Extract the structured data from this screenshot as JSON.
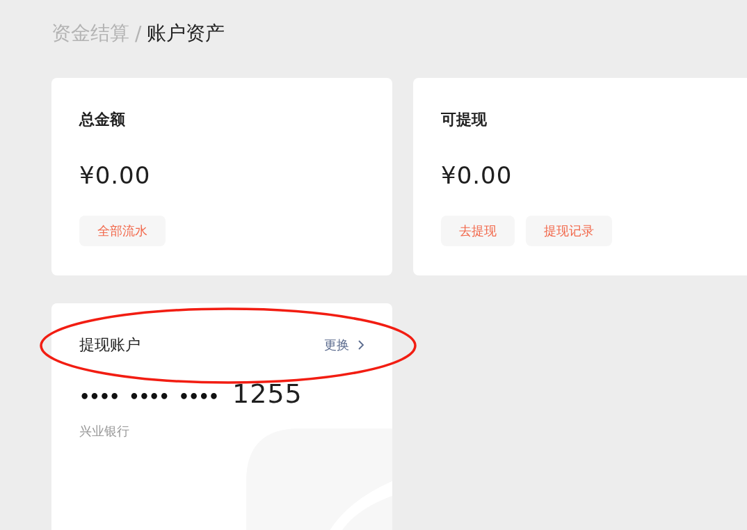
{
  "breadcrumb": {
    "parent": "资金结算",
    "separator": "/",
    "current": "账户资产"
  },
  "balance_cards": [
    {
      "title": "总金额",
      "amount": "¥0.00",
      "buttons": [
        "全部流水"
      ]
    },
    {
      "title": "可提现",
      "amount": "¥0.00",
      "buttons": [
        "去提现",
        "提现记录"
      ]
    }
  ],
  "account_card": {
    "title": "提现账户",
    "change_link": "更换",
    "masked_groups": [
      "••••",
      "••••",
      "••••"
    ],
    "last_digits": "1255",
    "bank": "兴业银行"
  },
  "annotation": {
    "kind": "ellipse",
    "color": "#f21d12"
  }
}
